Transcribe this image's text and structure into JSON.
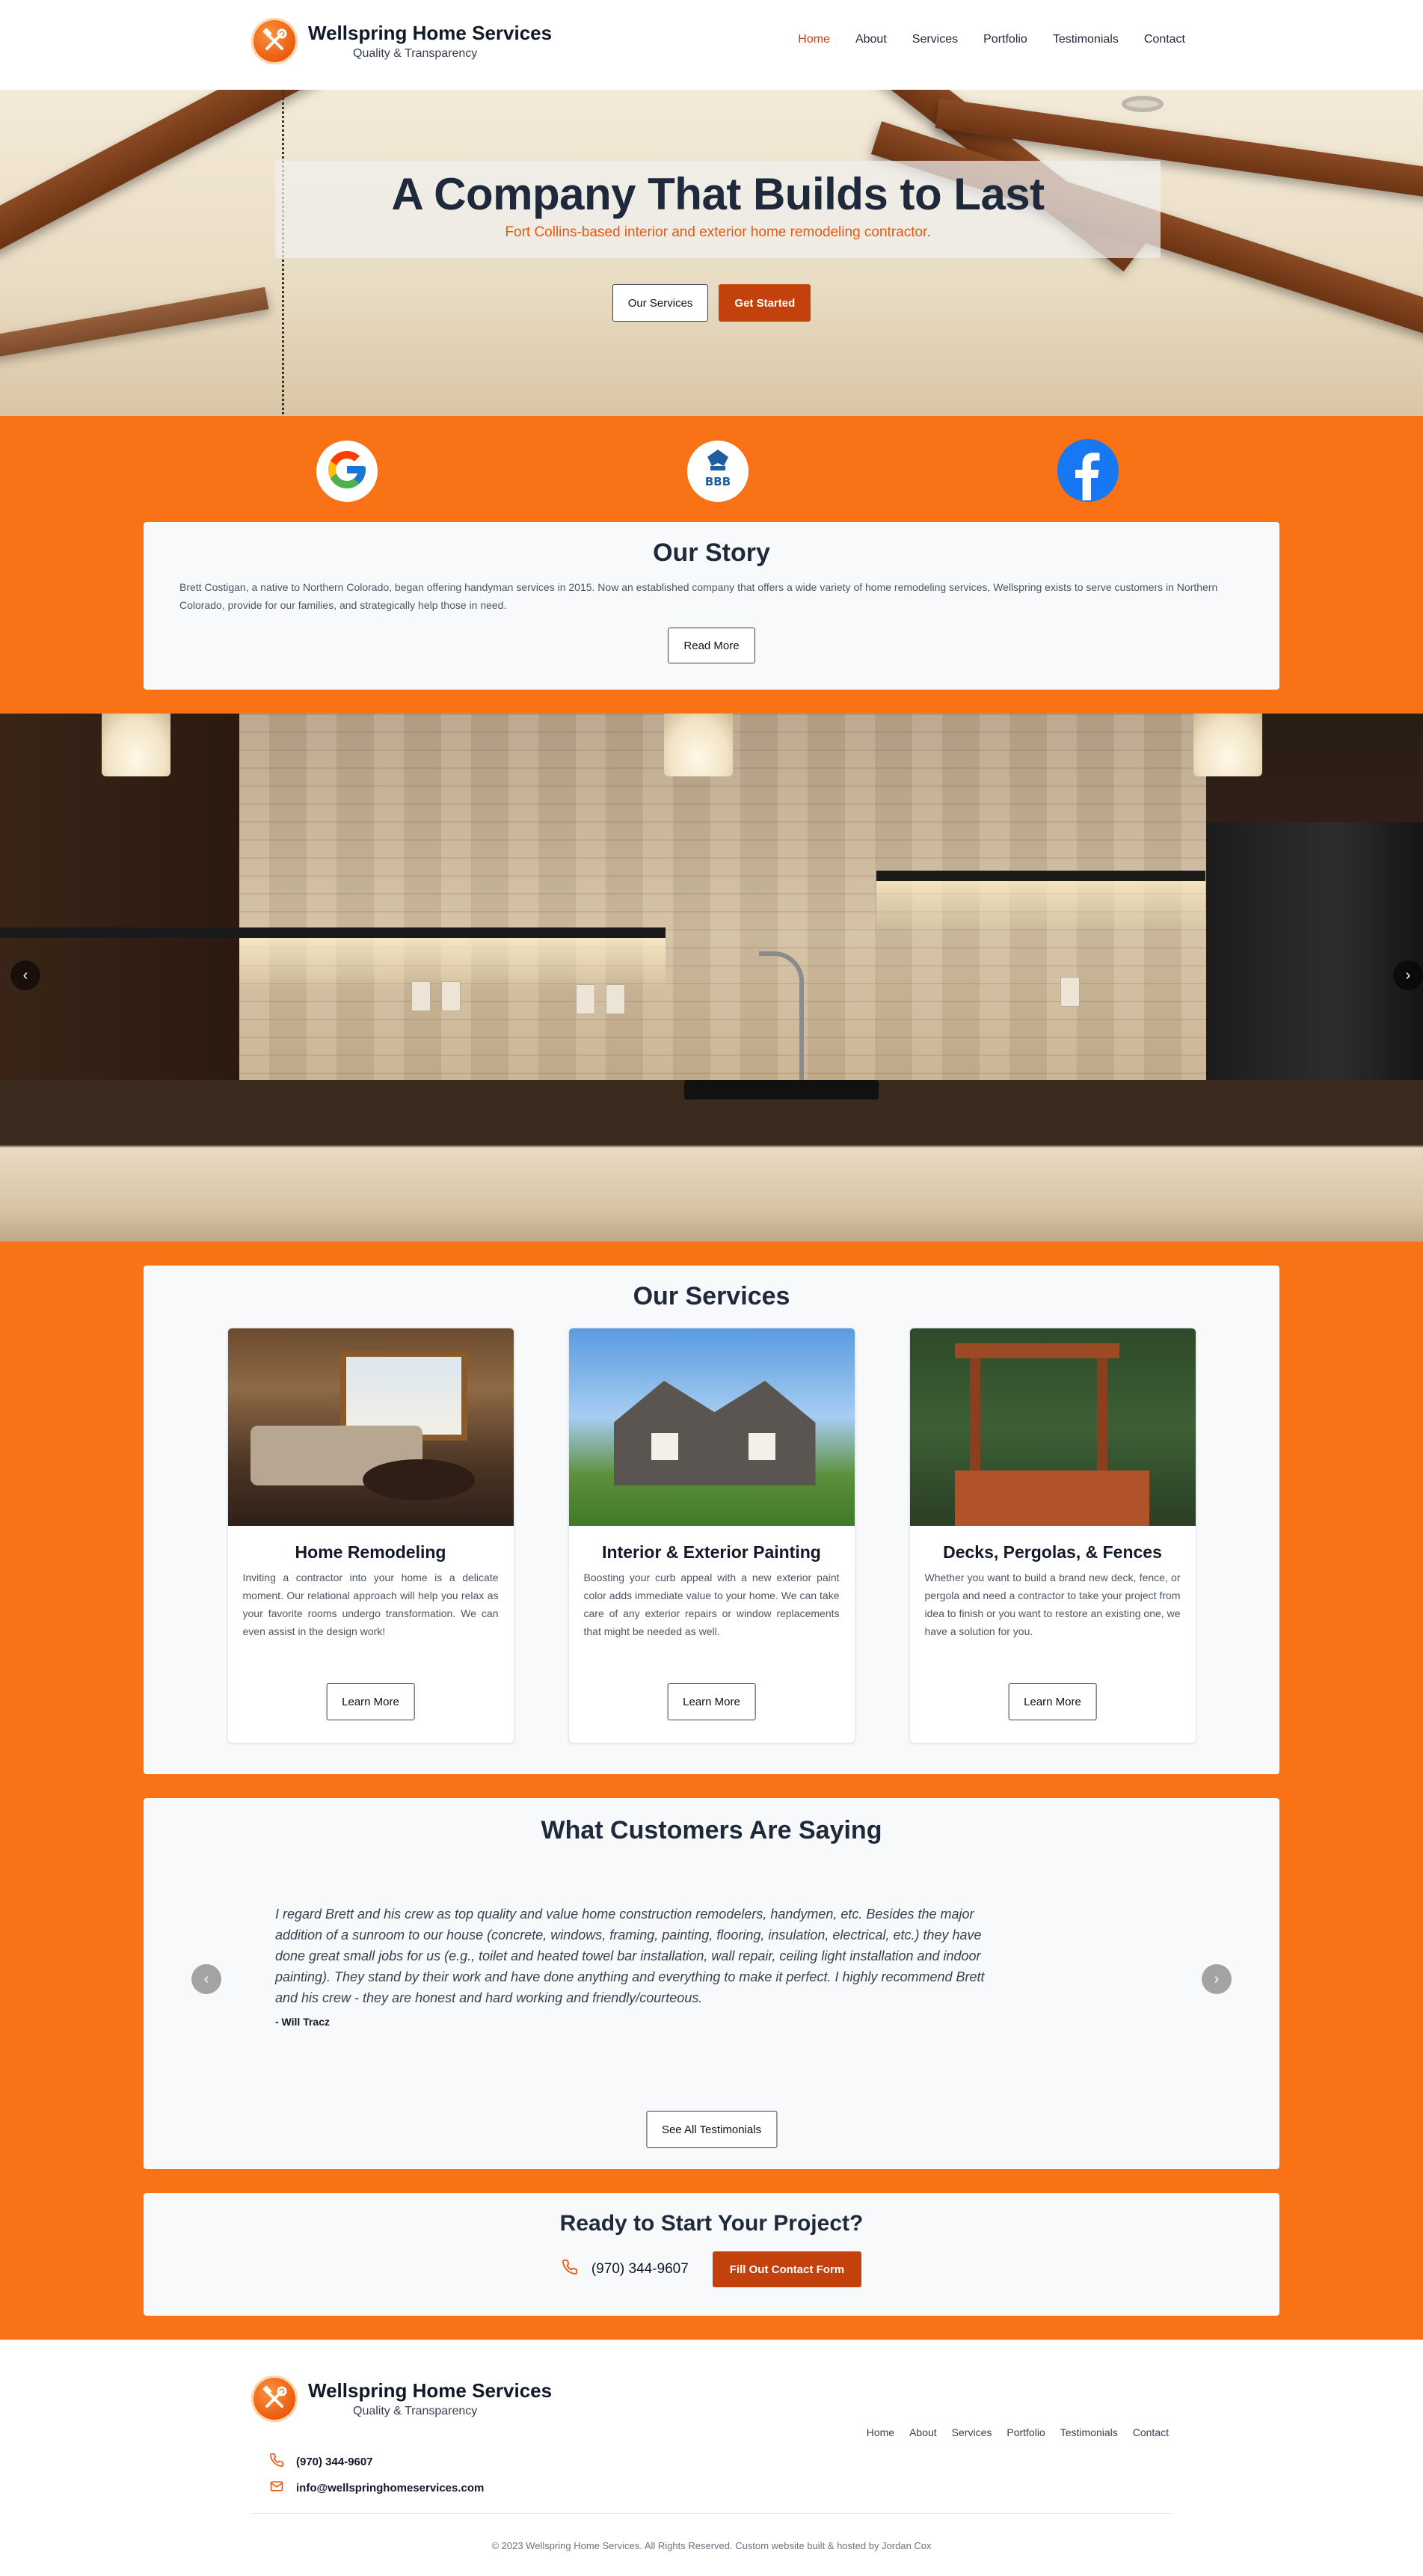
{
  "brand": {
    "name": "Wellspring Home Services",
    "tagline": "Quality & Transparency"
  },
  "nav": [
    "Home",
    "About",
    "Services",
    "Portfolio",
    "Testimonials",
    "Contact"
  ],
  "nav_active": "Home",
  "hero": {
    "title": "A Company That Builds to Last",
    "subtitle": "Fort Collins-based interior and exterior home remodeling contractor.",
    "btn_services": "Our Services",
    "btn_started": "Get Started"
  },
  "social": {
    "google": "G",
    "bbb": "BBB",
    "facebook": "f"
  },
  "story": {
    "title": "Our Story",
    "text": "Brett Costigan, a native to Northern Colorado, began offering handyman services in 2015. Now an established company that offers a wide variety of home remodeling services, Wellspring exists to serve customers in Northern Colorado, provide for our families, and strategically help those in need.",
    "button": "Read More"
  },
  "gallery": {
    "prev": "‹",
    "next": "›"
  },
  "services": {
    "title": "Our Services",
    "items": [
      {
        "title": "Home Remodeling",
        "desc": "Inviting a contractor into your home is a delicate moment. Our relational approach will help you relax as your favorite rooms undergo transformation. We can even assist in the design work!",
        "button": "Learn More"
      },
      {
        "title": "Interior & Exterior Painting",
        "desc": "Boosting your curb appeal with a new exterior paint color adds immediate value to your home. We can take care of any exterior repairs or window replacements that might be needed as well.",
        "button": "Learn More"
      },
      {
        "title": "Decks, Pergolas, & Fences",
        "desc": "Whether you want to build a brand new deck, fence, or pergola and need a contractor to take your project from idea to finish or you want to restore an existing one, we have a solution for you.",
        "button": "Learn More"
      }
    ]
  },
  "testimonials": {
    "title": "What Customers Are Saying",
    "quote": "I regard Brett and his crew as top quality and value home construction remodelers, handymen, etc. Besides the major addition of a sunroom to our house (concrete, windows, framing, painting, flooring, insulation, electrical, etc.) they have done great small jobs for us (e.g., toilet and heated towel bar installation, wall repair, ceiling light installation and indoor painting). They stand by their work and have done anything and everything to make it perfect. I highly recommend Brett and his crew - they are honest and hard working and friendly/courteous.",
    "author": "- Will Tracz",
    "prev": "‹",
    "next": "›",
    "button": "See All Testimonials"
  },
  "cta": {
    "title": "Ready to Start Your Project?",
    "phone": "(970) 344-9607",
    "button": "Fill Out Contact Form"
  },
  "footer": {
    "phone": "(970) 344-9607",
    "email": "info@wellspringhomeservices.com",
    "copyright": "© 2023 Wellspring Home Services. All Rights Reserved. Custom website built & hosted by Jordan Cox"
  },
  "colors": {
    "accent": "#f97316",
    "button": "#c2410c",
    "card": "#f8f9fa",
    "heading": "#1e293b"
  },
  "icons": [
    "hammer-wrench-logo-icon",
    "google-icon",
    "bbb-icon",
    "facebook-icon",
    "chevron-left-icon",
    "chevron-right-icon",
    "phone-icon",
    "email-icon"
  ]
}
